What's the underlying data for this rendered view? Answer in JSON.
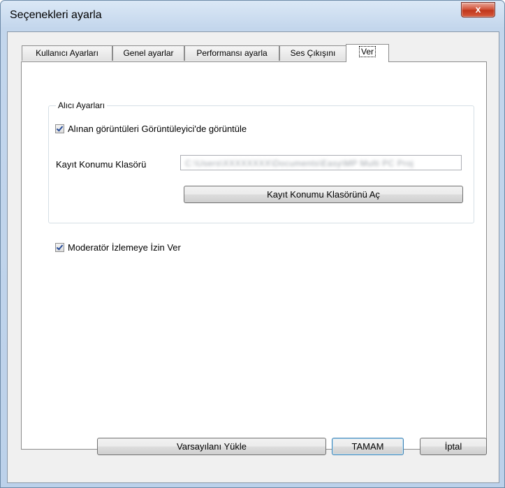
{
  "window": {
    "title": "Seçenekleri ayarla",
    "close_glyph": "x"
  },
  "tabs": [
    {
      "label": "Kullanıcı Ayarları"
    },
    {
      "label": "Genel ayarlar"
    },
    {
      "label": "Performansı ayarla"
    },
    {
      "label": "Ses Çıkışını"
    },
    {
      "label": "Ver",
      "active": true
    }
  ],
  "receiver": {
    "group_label": "Alıcı Ayarları",
    "show_images_label": "Alınan görüntüleri Görüntüleyici'de görüntüle",
    "show_images_checked": true,
    "save_location_label": "Kayıt Konumu Klasörü",
    "save_location_value": "C:\\Users\\XXXXXXXX\\Documents\\Easy\\MP Multi PC Proj",
    "open_folder_button": "Kayıt Konumu Klasörünü Aç"
  },
  "moderator": {
    "label": "Moderatör İzlemeye İzin Ver",
    "checked": true
  },
  "footer": {
    "load_defaults_button": "Varsayılanı Yükle",
    "ok_button": "TAMAM",
    "cancel_button": "İptal"
  }
}
